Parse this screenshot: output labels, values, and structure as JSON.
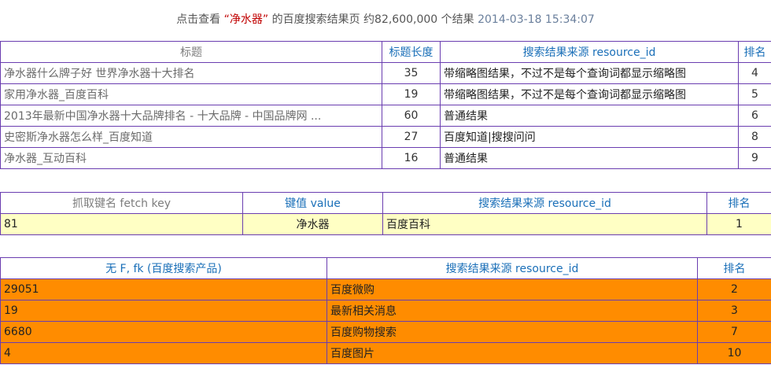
{
  "header": {
    "prefix": "点击查看",
    "keyword_quoted": "“净水器”",
    "suffix": "的百度搜索结果页",
    "count": "约82,600,000 个结果",
    "datetime": "2014-03-18 15:34:07"
  },
  "table1": {
    "headers": [
      "标题",
      "标题长度",
      "搜索结果来源 resource_id",
      "排名"
    ],
    "rows": [
      {
        "title": "净水器什么牌子好 世界净水器十大排名",
        "len": "35",
        "src": "带缩略图结果，不过不是每个查询词都显示缩略图",
        "rank": "4"
      },
      {
        "title": "家用净水器_百度百科",
        "len": "19",
        "src": "带缩略图结果，不过不是每个查询词都显示缩略图",
        "rank": "5"
      },
      {
        "title": "2013年最新中国净水器十大品牌排名 - 十大品牌 - 中国品牌网 ...",
        "len": "60",
        "src": "普通结果",
        "rank": "6"
      },
      {
        "title": "史密斯净水器怎么样_百度知道",
        "len": "27",
        "src": "百度知道|搜搜问问",
        "rank": "8"
      },
      {
        "title": "净水器_互动百科",
        "len": "16",
        "src": "普通结果",
        "rank": "9"
      }
    ]
  },
  "table2": {
    "headers": [
      "抓取键名 fetch key",
      "键值 value",
      "搜索结果来源 resource_id",
      "排名"
    ],
    "rows": [
      {
        "key": "81",
        "value": "净水器",
        "src": "百度百科",
        "rank": "1"
      }
    ]
  },
  "table3": {
    "headers": [
      "无 F, fk (百度搜索产品)",
      "搜索结果来源 resource_id",
      "排名"
    ],
    "rows": [
      {
        "id": "29051",
        "src": "百度微购",
        "rank": "2"
      },
      {
        "id": "19",
        "src": "最新相关消息",
        "rank": "3"
      },
      {
        "id": "6680",
        "src": "百度购物搜索",
        "rank": "7"
      },
      {
        "id": "4",
        "src": "百度图片",
        "rank": "10"
      }
    ]
  }
}
